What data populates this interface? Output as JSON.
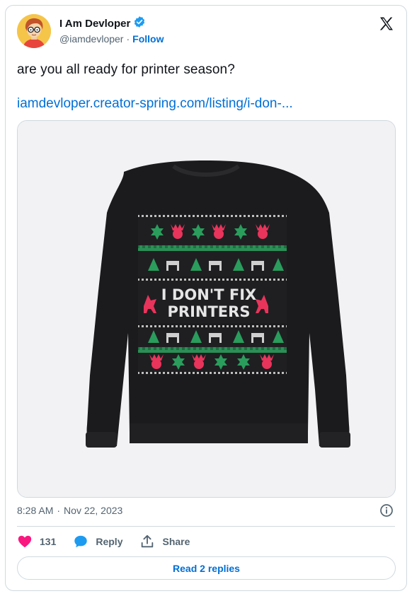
{
  "author": {
    "name": "I Am Devloper",
    "handle": "@iamdevloper",
    "separator": "·",
    "follow_label": "Follow"
  },
  "tweet": {
    "text": "are you all ready for printer season?",
    "link_text": "iamdevloper.creator-spring.com/listing/i-don-..."
  },
  "media": {
    "sweater_text_line1": "I DON'T FIX",
    "sweater_text_line2": "PRINTERS"
  },
  "meta": {
    "time": "8:28 AM",
    "separator": "·",
    "date": "Nov 22, 2023"
  },
  "actions": {
    "like_count": "131",
    "reply_label": "Reply",
    "share_label": "Share"
  },
  "read_replies_label": "Read 2 replies",
  "colors": {
    "accent": "#006fd6",
    "like": "#f91880",
    "verified": "#1d9bf0",
    "border": "#cfd9de"
  }
}
